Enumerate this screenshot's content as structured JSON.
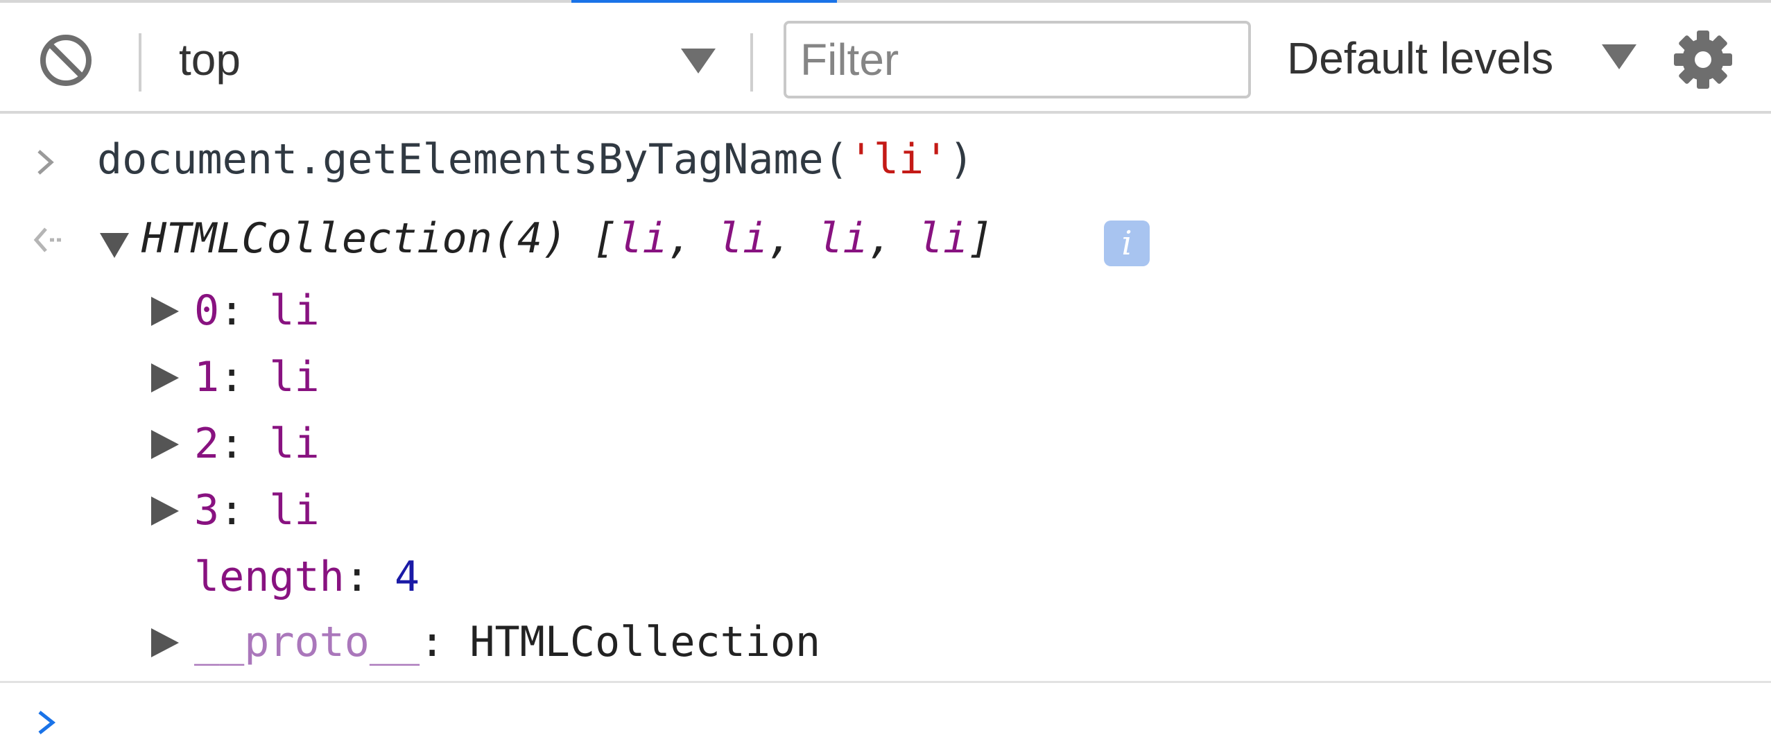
{
  "toolbar": {
    "context": "top",
    "filter_placeholder": "Filter",
    "filter_value": "",
    "levels_label": "Default levels"
  },
  "console": {
    "command_prefix": "document.getElementsByTagName(",
    "command_string": "'li'",
    "command_suffix": ")",
    "result": {
      "type_label": "HTMLCollection(4)",
      "open_bracket": " [",
      "item_separator": ", ",
      "items": [
        "li",
        "li",
        "li",
        "li"
      ],
      "close_bracket": "]",
      "info_badge": "i",
      "entries": [
        {
          "key": "0",
          "value": "li"
        },
        {
          "key": "1",
          "value": "li"
        },
        {
          "key": "2",
          "value": "li"
        },
        {
          "key": "3",
          "value": "li"
        }
      ],
      "length_key": "length",
      "length_value": "4",
      "proto_key": "__proto__",
      "proto_value": "HTMLCollection",
      "colon": ": "
    }
  },
  "colors": {
    "accent": "#1a73e8",
    "property_purple": "#881280",
    "string_red": "#c41a16",
    "number_blue": "#1a1aa6"
  },
  "icons": {
    "clear": "clear-console-icon",
    "dropdown": "triangle-down-icon",
    "settings": "gear-icon",
    "prompt": "chevron-right-icon",
    "result": "result-arrow-icon",
    "expand": "triangle-right-icon",
    "collapse": "triangle-down-icon",
    "info": "info-icon"
  }
}
